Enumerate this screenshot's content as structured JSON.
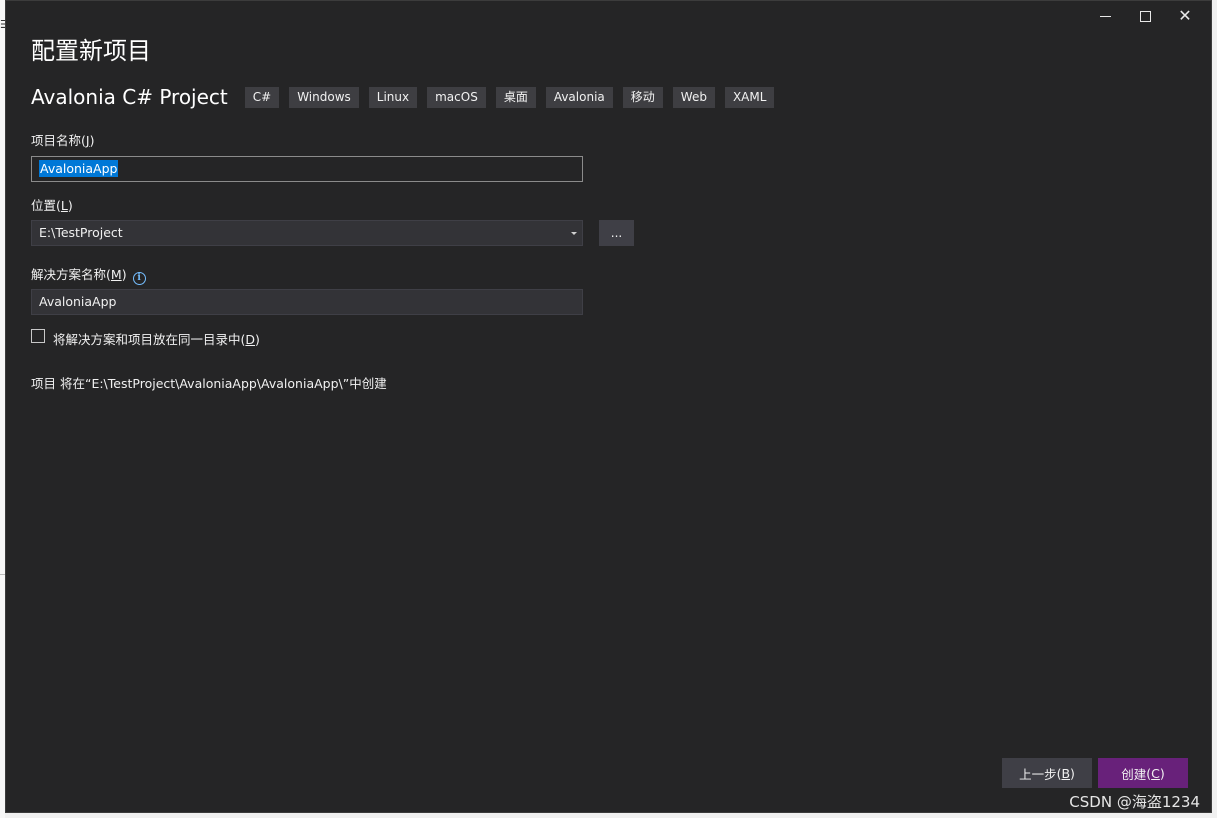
{
  "window": {
    "title": "配置新项目",
    "controls": {
      "minimize_icon": "minimize-icon",
      "maximize_icon": "maximize-icon",
      "close_icon": "close-icon",
      "close_glyph": "✕"
    }
  },
  "template": {
    "name": "Avalonia C# Project",
    "tags": [
      "C#",
      "Windows",
      "Linux",
      "macOS",
      "桌面",
      "Avalonia",
      "移动",
      "Web",
      "XAML"
    ]
  },
  "project_name": {
    "label": "项目名称",
    "accel": "J",
    "value": "AvaloniaApp"
  },
  "location": {
    "label": "位置",
    "accel": "L",
    "value": "E:\\TestProject",
    "browse_label": "..."
  },
  "solution_name": {
    "label": "解决方案名称",
    "accel": "M",
    "info_glyph": "i",
    "value": "AvaloniaApp"
  },
  "same_directory": {
    "label": "将解决方案和项目放在同一目录中",
    "accel": "D",
    "checked": false
  },
  "path_info": "项目 将在“E:\\TestProject\\AvaloniaApp\\AvaloniaApp\\”中创建",
  "buttons": {
    "back": {
      "label": "上一步",
      "accel": "B"
    },
    "create": {
      "label": "创建",
      "accel": "C"
    }
  },
  "watermark": "CSDN @海盗1234",
  "colors": {
    "background": "#252526",
    "input": "#333337",
    "accent_create": "#68217a",
    "selection": "#0078d7",
    "info": "#75beff"
  }
}
